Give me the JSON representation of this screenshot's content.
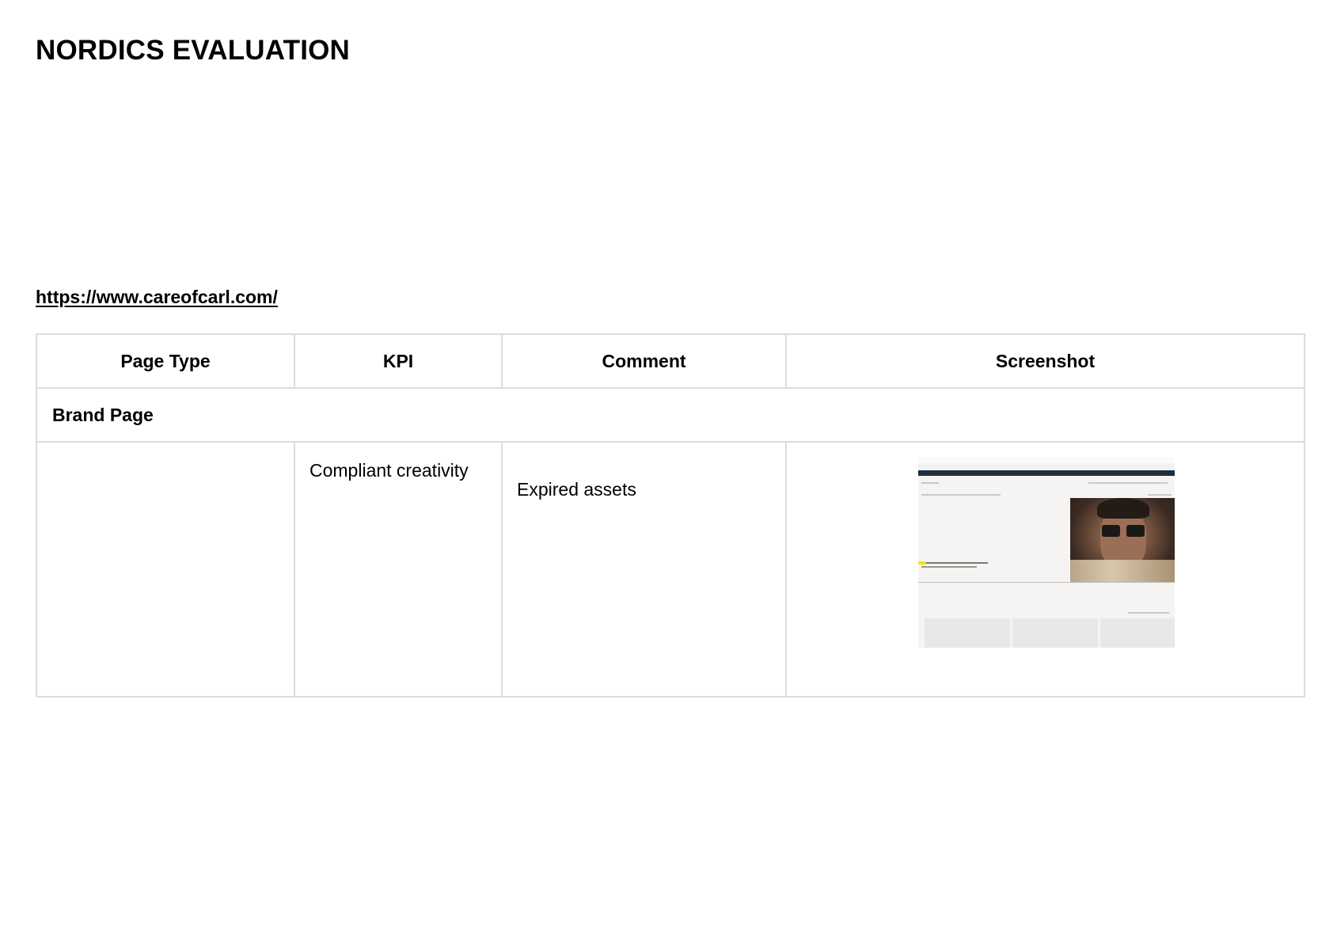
{
  "document": {
    "title": "NORDICS EVALUATION",
    "url": "https://www.careofcarl.com/"
  },
  "table": {
    "headers": [
      "Page Type",
      "KPI",
      "Comment",
      "Screenshot"
    ],
    "section": "Brand Page",
    "rows": [
      {
        "page_type": "",
        "kpi": "Compliant creativity",
        "comment": "Expired assets"
      }
    ]
  },
  "screenshot": {
    "alt": "website screenshot thumbnail"
  }
}
